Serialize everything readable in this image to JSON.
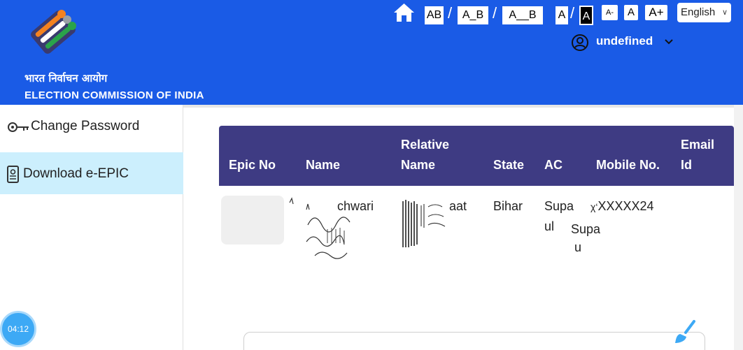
{
  "header": {
    "org_hindi": "भारत निर्वाचन आयोग",
    "org_english": "ELECTION COMMISSION OF INDIA",
    "spacing_buttons": [
      "AB",
      "A_B",
      "A__B"
    ],
    "contrast_buttons": [
      "A",
      "A"
    ],
    "font_buttons": [
      "A-",
      "A",
      "A+"
    ],
    "language": "English",
    "user_name": "undefined",
    "icons": {
      "home": "home-icon",
      "user": "user-circle-icon",
      "dropdown": "chevron-down-icon"
    },
    "colors": {
      "bar": "#1a5be6"
    }
  },
  "sidebar": {
    "items": [
      {
        "label": "Change Password",
        "icon": "key-icon",
        "active": false
      },
      {
        "label": "Download e-EPIC",
        "icon": "id-card-icon",
        "active": true
      }
    ],
    "timer": "04:12",
    "colors": {
      "active_bg": "#cceffd"
    }
  },
  "table": {
    "headers": {
      "epic_no": "Epic No",
      "name": "Name",
      "relative_name_1": "Relative",
      "relative_name_2": "Name",
      "state": "State",
      "ac": "AC",
      "mobile": "Mobile No.",
      "email_1": "Email",
      "email_2": "Id"
    },
    "row": {
      "name_fragment": "chwari",
      "relative_fragment": "aat",
      "state": "Bihar",
      "ac_1": "Supa",
      "ac_2": "ul",
      "ac_3": "Supa",
      "ac_4": "u",
      "mobile": "XXXXX24"
    },
    "colors": {
      "header_bg": "#3e3b83"
    }
  }
}
